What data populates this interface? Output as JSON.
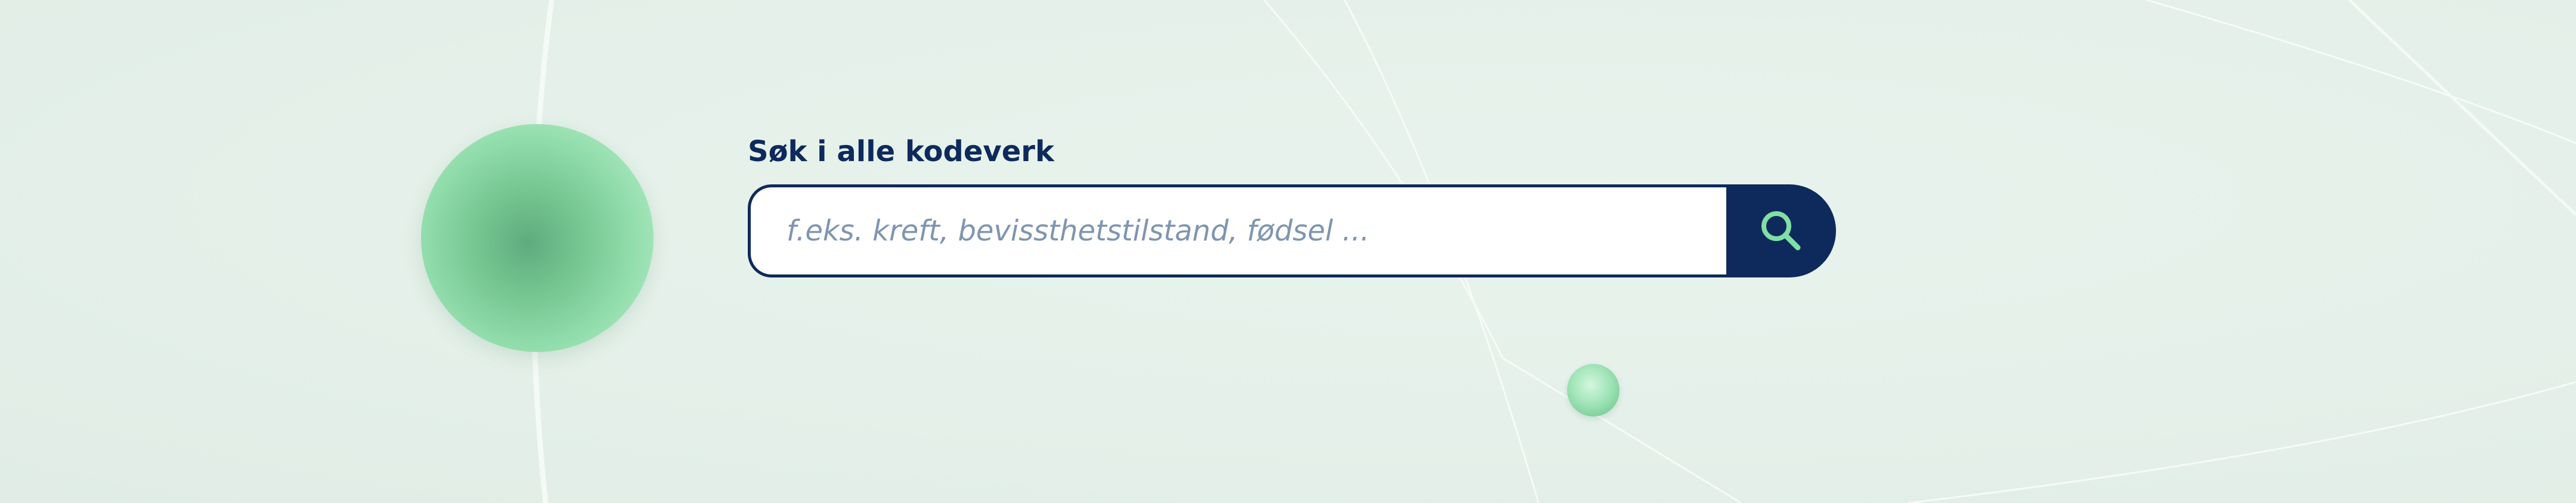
{
  "search": {
    "title": "Søk i alle kodeverk",
    "placeholder": "f.eks. kreft, bevissthetstilstand, fødsel ...",
    "value": "",
    "button_icon": "search-icon"
  },
  "colors": {
    "background": "#e4f0e9",
    "navy": "#0e2a5c",
    "accent_green": "#7fe0a4",
    "placeholder": "#7f95b1"
  }
}
